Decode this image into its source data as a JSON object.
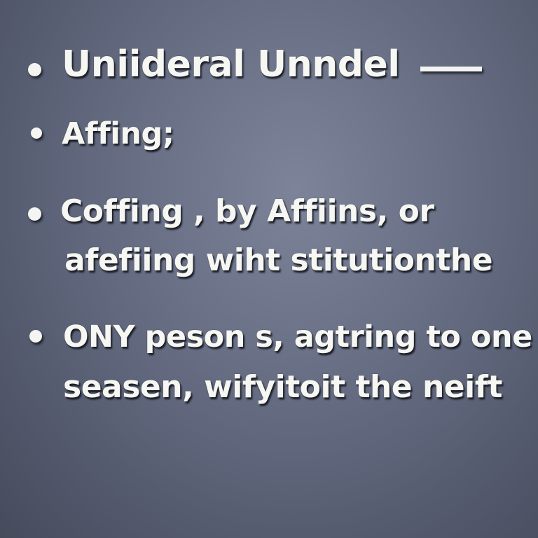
{
  "bullets": [
    {
      "lines": [
        "Uniideral  Unndel"
      ],
      "trailing_dash": true
    },
    {
      "lines": [
        "Affing;"
      ]
    },
    {
      "lines": [
        "Coffing , by Affiins, or",
        "afefiing wiht stitutionthe"
      ]
    },
    {
      "lines": [
        "ONY peson s, agtring to one",
        "seasen, wifyitoit the  neift"
      ]
    }
  ],
  "colors": {
    "background_center": "#7d8499",
    "background_edge": "#464b5c",
    "text": "#f6f6f2"
  }
}
